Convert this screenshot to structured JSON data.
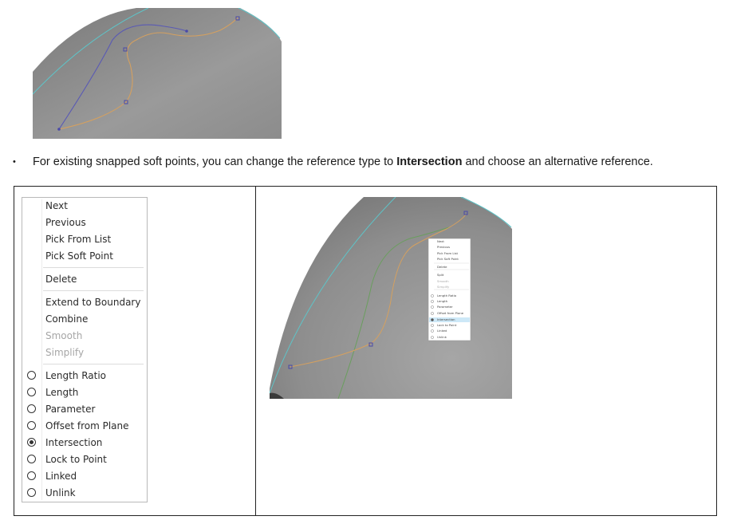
{
  "bullet": {
    "marker": "•",
    "text_before": "For existing snapped soft points, you can change the reference type to ",
    "text_bold": "Intersection",
    "text_after": " and choose an alternative reference."
  },
  "context_menu": {
    "items": [
      "Next",
      "Previous",
      "Pick From List",
      "Pick Soft Point",
      "Delete",
      "Extend to Boundary",
      "Combine",
      "Smooth",
      "Simplify"
    ],
    "radio_items": [
      "Length Ratio",
      "Length",
      "Parameter",
      "Offset from Plane",
      "Intersection",
      "Lock to Point",
      "Linked",
      "Unlink"
    ],
    "selected_radio": "Intersection",
    "disabled_items": [
      "Smooth",
      "Simplify"
    ]
  },
  "mini_menu": {
    "items": [
      "Next",
      "Previous",
      "Pick From List",
      "Pick Soft Point",
      "Delete",
      "Split",
      "Smooth",
      "Simplify",
      "Length Ratio",
      "Length",
      "Parameter",
      "Offset from Plane",
      "Intersection",
      "Lock to Point",
      "Linked",
      "Unlink"
    ]
  },
  "colors": {
    "surface_gray": "#8e8e8e",
    "curve_blue": "#5a5ab4",
    "curve_orange": "#d4a060",
    "edge_cyan": "#5ec4c8",
    "curve_green": "#6a9e5e",
    "selected_highlight": "#cde8f7"
  }
}
